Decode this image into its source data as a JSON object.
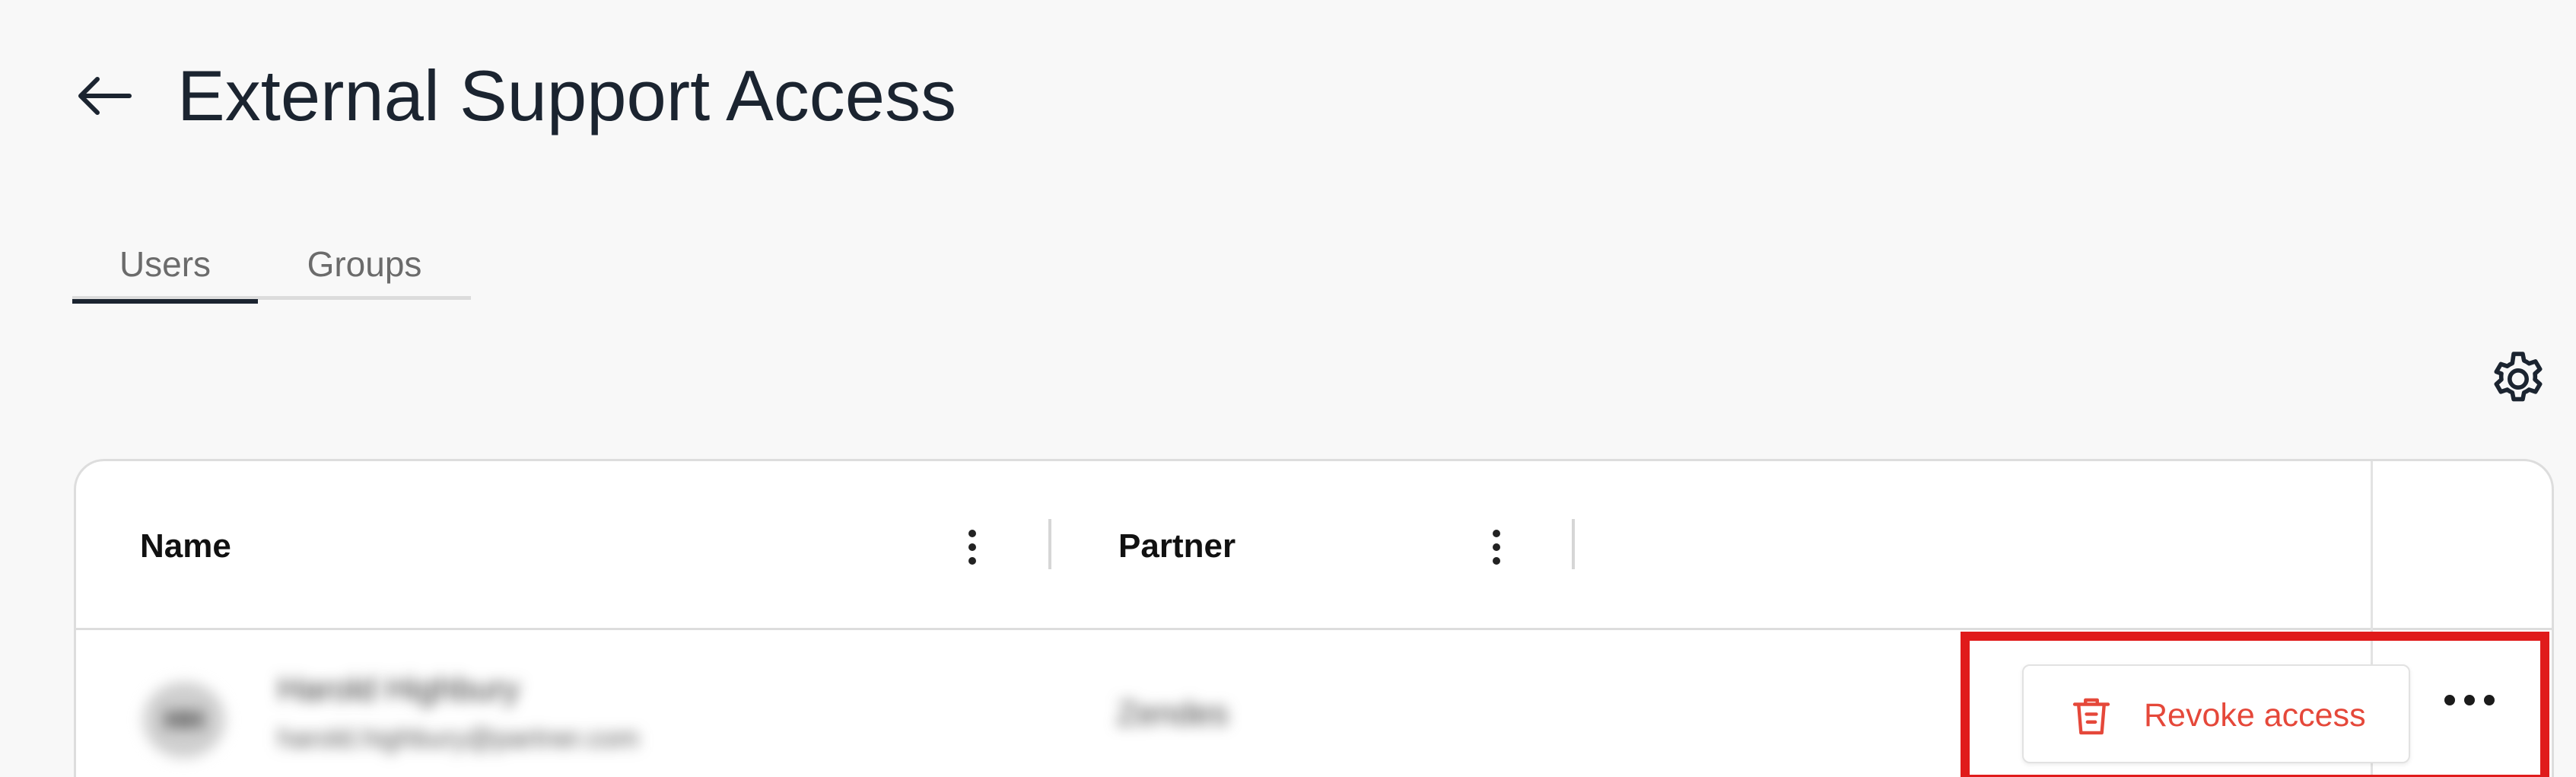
{
  "header": {
    "title": "External Support Access",
    "back_icon": "arrow-left-icon"
  },
  "tabs": [
    {
      "label": "Users",
      "active": true
    },
    {
      "label": "Groups",
      "active": false
    }
  ],
  "toolbar": {
    "settings_icon": "gear-icon"
  },
  "table": {
    "columns": [
      {
        "label": "Name"
      },
      {
        "label": "Partner"
      }
    ],
    "rows": [
      {
        "avatar_initials": "HH",
        "name": "Harold Highbury",
        "email": "harold.highbury@partner.com",
        "partner": "Zendes",
        "action_label": "Revoke access"
      }
    ]
  },
  "colors": {
    "accent_red": "#e5483a",
    "highlight": "#e01b1b",
    "text_primary": "#1b2430"
  }
}
